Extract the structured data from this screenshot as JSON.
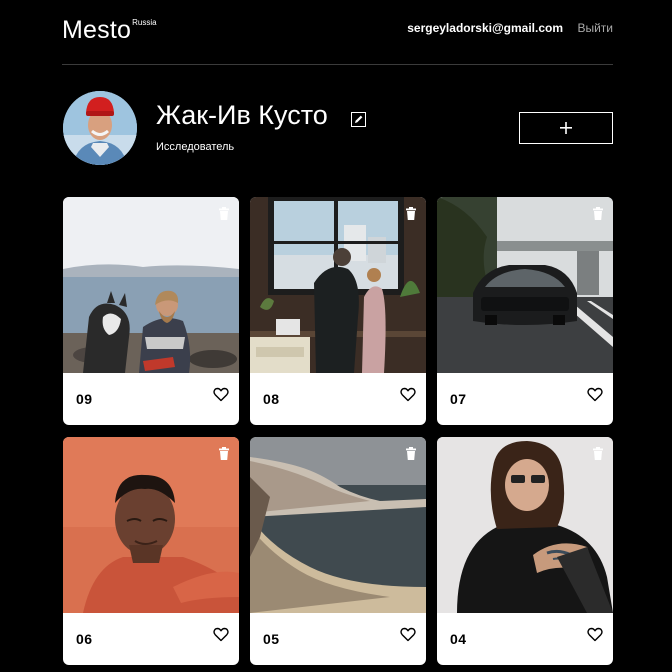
{
  "header": {
    "logo": "Mesto",
    "logo_sup": "Russia",
    "email": "sergeyladorski@gmail.com",
    "logout": "Выйти"
  },
  "profile": {
    "name": "Жак-Ив Кусто",
    "about": "Исследователь"
  },
  "cards": [
    {
      "title": "09"
    },
    {
      "title": "08"
    },
    {
      "title": "07"
    },
    {
      "title": "06"
    },
    {
      "title": "05"
    },
    {
      "title": "04"
    }
  ],
  "icons": {
    "edit": "pencil-icon",
    "add": "plus-icon",
    "delete": "trash-icon",
    "like": "heart-icon"
  }
}
